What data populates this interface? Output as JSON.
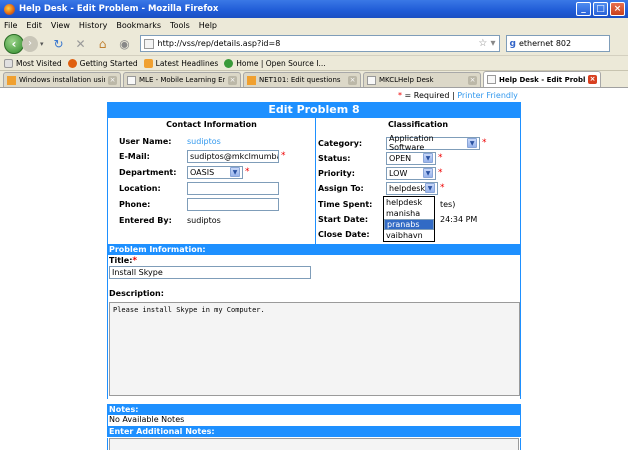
{
  "window": {
    "title": "Help Desk - Edit Problem - Mozilla Firefox"
  },
  "menu": [
    "File",
    "Edit",
    "View",
    "History",
    "Bookmarks",
    "Tools",
    "Help"
  ],
  "nav": {
    "url": "http://vss/rep/details.asp?id=8",
    "search": "ethernet 802"
  },
  "bookmarks": [
    "Most Visited",
    "Getting Started",
    "Latest Headlines",
    "Home | Open Source I..."
  ],
  "tabs": [
    "Windows installation using ...",
    "MLE - Mobile Learning Engine",
    "NET101: Edit questions",
    "MKCLHelp Desk",
    "Help Desk - Edit Problem"
  ],
  "page": {
    "required_note": "= Required",
    "required_star": "*",
    "separator": "|",
    "printer_friendly": "Printer Friendly",
    "heading": "Edit Problem 8",
    "contact": {
      "title": "Contact Information",
      "user_name_label": "User Name:",
      "user_name": "sudiptos",
      "email_label": "E-Mail:",
      "email": "sudiptos@mkclmumbai",
      "department_label": "Department:",
      "department": "OASIS",
      "location_label": "Location:",
      "location": "",
      "phone_label": "Phone:",
      "phone": "",
      "entered_by_label": "Entered By:",
      "entered_by": "sudiptos"
    },
    "classification": {
      "title": "Classification",
      "category_label": "Category:",
      "category": "Application Software",
      "status_label": "Status:",
      "status": "OPEN",
      "priority_label": "Priority:",
      "priority": "LOW",
      "assign_label": "Assign To:",
      "assign": "helpdesk",
      "time_spent_label": "Time Spent:",
      "time_spent": "tes)",
      "start_date_label": "Start Date:",
      "start_date": "24:34 PM",
      "close_date_label": "Close Date:",
      "close_date": ""
    },
    "assign_options": [
      "helpdesk",
      "manisha",
      "pranabs",
      "vaibhavn"
    ],
    "assign_highlight": "pranabs",
    "problem_info": "Problem Information:",
    "title_label": "Title:",
    "title_value": "Install Skype",
    "description_label": "Description:",
    "description_value": "Please install Skype in my Computer.",
    "notes_header": "Notes:",
    "notes_value": "No Available Notes",
    "additional_notes_header": "Enter Additional Notes:"
  }
}
